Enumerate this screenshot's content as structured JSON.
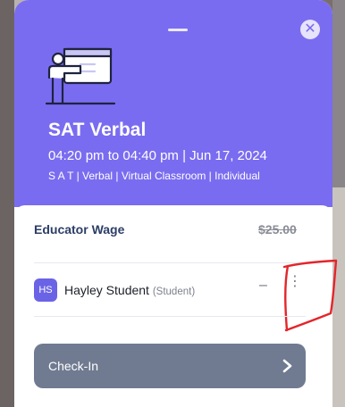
{
  "modal": {
    "title": "SAT Verbal",
    "schedule": "04:20 pm to 04:40 pm | Jun 17, 2024",
    "tags": "S A T | Verbal | Virtual Classroom | Individual",
    "close_glyph": "✕"
  },
  "wage": {
    "label": "Educator Wage",
    "value": "$25.00"
  },
  "student": {
    "initials": "HS",
    "name": "Hayley Student",
    "role": "(Student)",
    "dash": "–",
    "menu_glyph": "⋮"
  },
  "actions": {
    "checkin_label": "Check-In"
  },
  "colors": {
    "header": "#7a6cf0",
    "button": "#707b91",
    "avatar": "#6b63e6",
    "annotation": "#e3262b"
  },
  "icons": {
    "close": "close-icon",
    "class": "classroom-icon",
    "menu": "kebab-menu-icon",
    "chevron": "chevron-right-icon"
  }
}
